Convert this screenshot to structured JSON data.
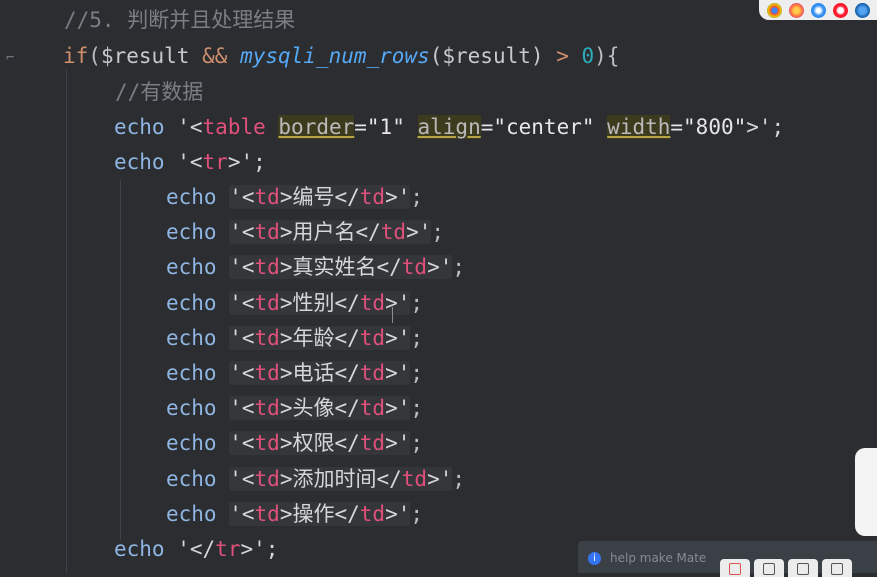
{
  "comment_line": "//5. 判断并且处理结果",
  "if_line": {
    "kw": "if",
    "open": "(",
    "var1": "$result",
    "and": "&&",
    "fn": "mysqli_num_rows",
    "var2": "($result)",
    "gt": ">",
    "zero": "0",
    "close": "){"
  },
  "comment2": "//有数据",
  "table_line": {
    "echo": "echo",
    "q1": "'<",
    "tag": "table",
    "attr1": "border",
    "val1": "=\"1\"",
    "attr2": "align",
    "val2": "=\"center\"",
    "attr3": "width",
    "val3": "=\"800\"",
    "end": ">';"
  },
  "tr_open": {
    "echo": "echo",
    "pre": "'<",
    "tag": "tr",
    "end": ">';"
  },
  "td_rows": [
    {
      "echo": "echo",
      "label": "编号",
      "tag": "td"
    },
    {
      "echo": "echo",
      "label": "用户名",
      "tag": "td"
    },
    {
      "echo": "echo",
      "label": "真实姓名",
      "tag": "td"
    },
    {
      "echo": "echo",
      "label": "性别",
      "tag": "td"
    },
    {
      "echo": "echo",
      "label": "年龄",
      "tag": "td"
    },
    {
      "echo": "echo",
      "label": "电话",
      "tag": "td"
    },
    {
      "echo": "echo",
      "label": "头像",
      "tag": "td"
    },
    {
      "echo": "echo",
      "label": "权限",
      "tag": "td"
    },
    {
      "echo": "echo",
      "label": "添加时间",
      "tag": "td"
    },
    {
      "echo": "echo",
      "label": "操作",
      "tag": "td"
    }
  ],
  "tr_close": {
    "echo": "echo",
    "pre": "'</",
    "tag": "tr",
    "end": ">';"
  },
  "notification": {
    "text": "help make Mate"
  },
  "browser_icons": [
    "chrome-icon",
    "firefox-icon",
    "safari-icon",
    "opera-icon",
    "edge-icon"
  ],
  "colors": {
    "background": "#2b2d30",
    "keyword": "#cf8e6d",
    "tag": "#e0507a",
    "function": "#56a8f5"
  }
}
